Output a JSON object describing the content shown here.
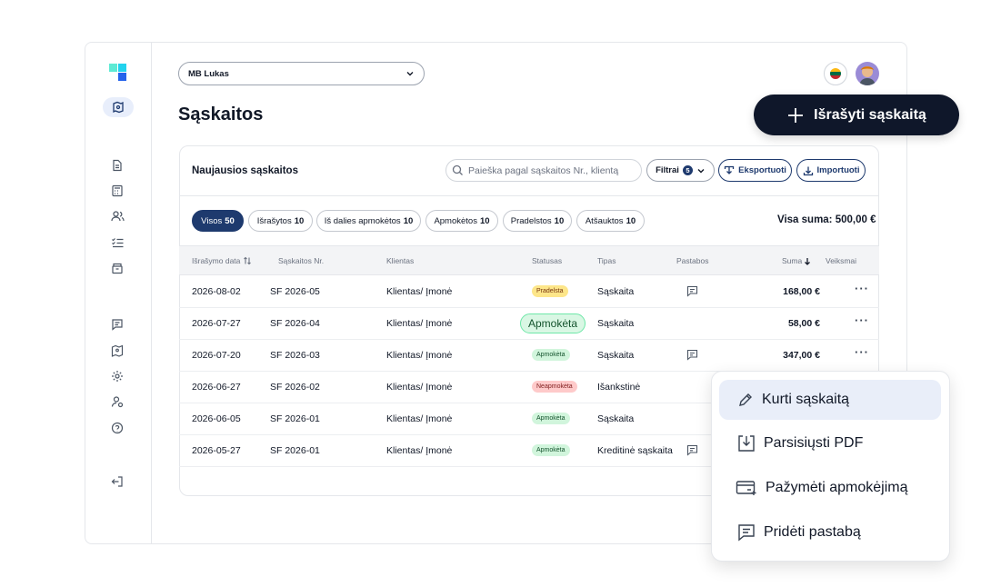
{
  "colors": {
    "primary": "#1e3a6e",
    "cta_bg": "#0f172a",
    "paid": "#d1f5dc",
    "late": "#fde68a",
    "unpaid": "#fecaca"
  },
  "header": {
    "org_name": "MB Lukas",
    "page_title": "Sąskaitos",
    "cta_label": "Išrašyti sąskaitą",
    "language_icon": "lithuania-flag-icon",
    "avatar": "user-avatar"
  },
  "sidebar": {
    "items": [
      "invoices-icon",
      "calculator-icon",
      "clients-icon",
      "tasks-icon",
      "products-icon",
      "messages-icon",
      "map-icon",
      "settings-icon",
      "profile-icon",
      "help-icon",
      "logout-icon"
    ]
  },
  "card": {
    "title": "Naujausios sąskaitos",
    "search_placeholder": "Paieška pagal sąskaitos Nr., klientą",
    "filters_label": "Filtrai",
    "filters_count": "5",
    "export_label": "Eksportuoti",
    "import_label": "Importuoti",
    "tabs": [
      {
        "label": "Visos",
        "count": "50"
      },
      {
        "label": "Išrašytos",
        "count": "10"
      },
      {
        "label": "Iš dalies apmokėtos",
        "count": "10"
      },
      {
        "label": "Apmokėtos",
        "count": "10"
      },
      {
        "label": "Pradelstos",
        "count": "10"
      },
      {
        "label": "Atšauktos",
        "count": "10"
      }
    ],
    "total": "Visa suma: 500,00 €",
    "columns": [
      "Išrašymo data",
      "Sąskaitos Nr.",
      "Klientas",
      "Statusas",
      "Tipas",
      "Pastabos",
      "Suma",
      "Veiksmai"
    ],
    "rows": [
      {
        "date": "2026-08-02",
        "number": "SF 2026-05",
        "client": "Klientas/ Įmonė",
        "status": "Pradelsta",
        "type": "Sąskaita",
        "note": true,
        "amount": "168,00 €"
      },
      {
        "date": "2026-07-27",
        "number": "SF 2026-04",
        "client": "Klientas/ Įmonė",
        "status": "Apmokėta",
        "type": "Sąskaita",
        "note": false,
        "amount": "58,00 €"
      },
      {
        "date": "2026-07-20",
        "number": "SF 2026-03",
        "client": "Klientas/ Įmonė",
        "status": "Apmokėta",
        "type": "Sąskaita",
        "note": true,
        "amount": "347,00 €"
      },
      {
        "date": "2026-06-27",
        "number": "SF 2026-02",
        "client": "Klientas/ Įmonė",
        "status": "Neapmokėta",
        "type": "Išankstinė",
        "note": false,
        "amount": ""
      },
      {
        "date": "2026-06-05",
        "number": "SF 2026-01",
        "client": "Klientas/ Įmonė",
        "status": "Apmokėta",
        "type": "Sąskaita",
        "note": false,
        "amount": ""
      },
      {
        "date": "2026-05-27",
        "number": "SF 2026-01",
        "client": "Klientas/ Įmonė",
        "status": "Apmokėta",
        "type": "Kreditinė sąskaita",
        "note": true,
        "amount": ""
      }
    ],
    "row_actions": "···"
  },
  "context_menu": {
    "items": [
      {
        "label": "Kurti sąskaitą",
        "icon": "pencil-icon"
      },
      {
        "label": "Parsisiųsti PDF",
        "icon": "download-icon"
      },
      {
        "label": "Pažymėti apmokėjimą",
        "icon": "card-payment-icon"
      },
      {
        "label": "Pridėti pastabą",
        "icon": "comment-icon"
      }
    ]
  }
}
